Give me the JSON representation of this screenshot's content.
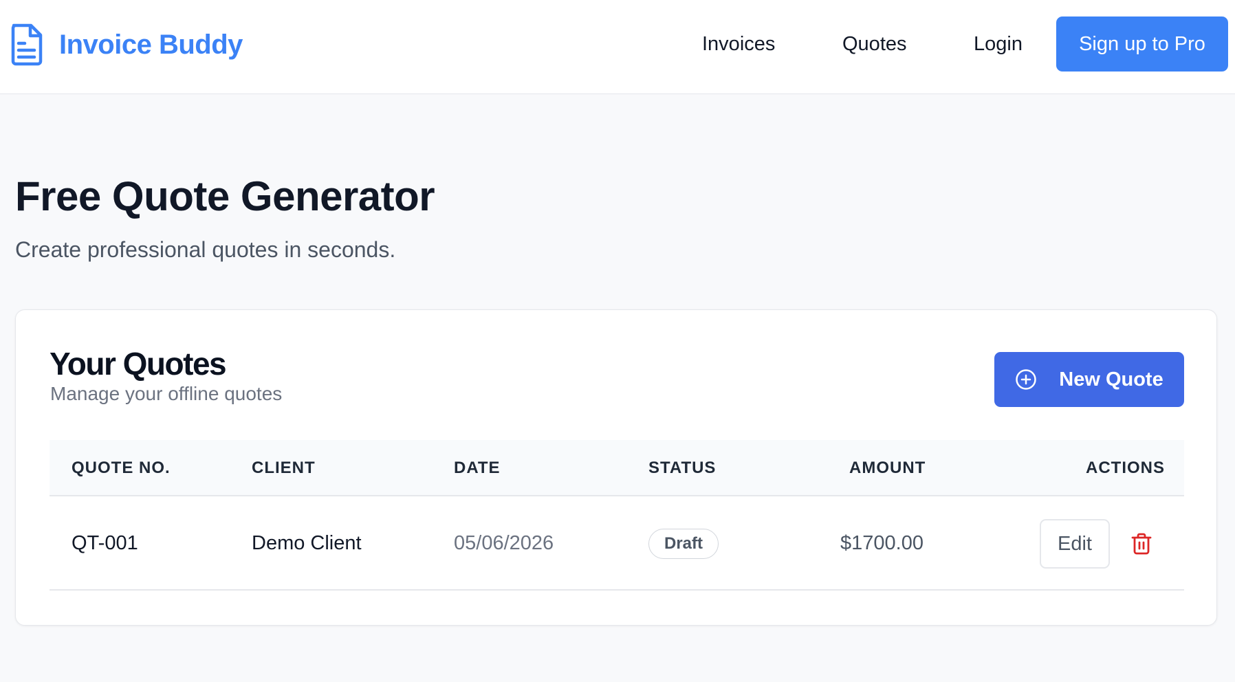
{
  "colors": {
    "brand": "#3b82f6",
    "primary_button": "#4069e5",
    "danger": "#dc2626",
    "text_dark": "#111827",
    "text_muted": "#6b7280",
    "background": "#f8f9fb"
  },
  "header": {
    "brand_icon": "document-icon",
    "brand_name": "Invoice Buddy",
    "nav": [
      "Invoices",
      "Quotes",
      "Login"
    ],
    "cta_label": "Sign up to Pro"
  },
  "page": {
    "title": "Free Quote Generator",
    "subtitle": "Create professional quotes in seconds."
  },
  "quotes_card": {
    "title": "Your Quotes",
    "subtitle": "Manage your offline quotes",
    "new_button_icon": "plus-circle-icon",
    "new_button_label": "New Quote",
    "columns": [
      "QUOTE NO.",
      "CLIENT",
      "DATE",
      "STATUS",
      "AMOUNT",
      "ACTIONS"
    ],
    "rows": [
      {
        "quote_no": "QT-001",
        "client": "Demo Client",
        "date": "05/06/2026",
        "status": "Draft",
        "amount": "$1700.00",
        "edit_label": "Edit",
        "delete_icon": "trash-icon"
      }
    ]
  }
}
